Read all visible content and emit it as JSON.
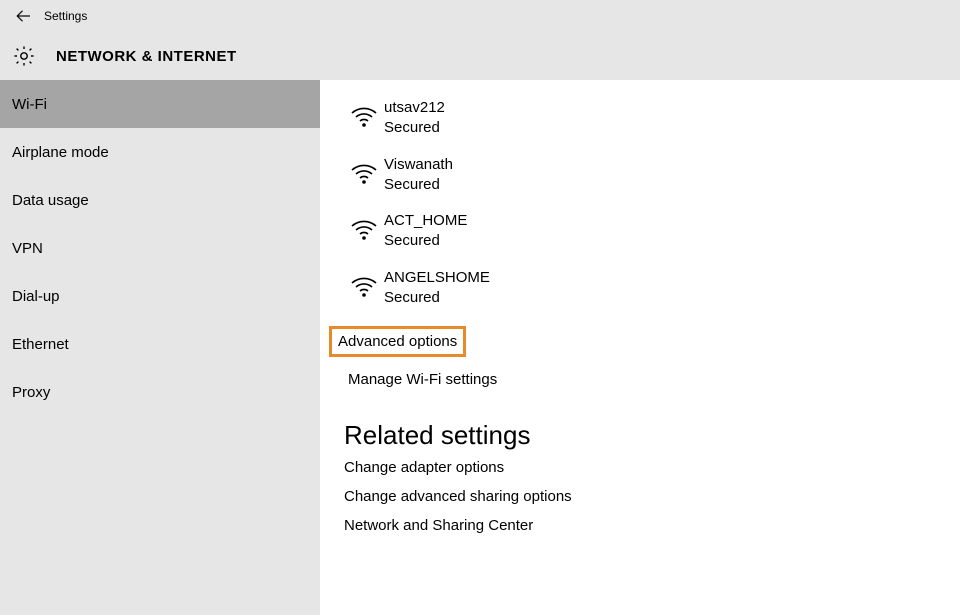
{
  "topbar": {
    "title": "Settings"
  },
  "header": {
    "title": "NETWORK & INTERNET"
  },
  "sidebar": {
    "items": [
      {
        "label": "Wi-Fi",
        "active": true
      },
      {
        "label": "Airplane mode"
      },
      {
        "label": "Data usage"
      },
      {
        "label": "VPN"
      },
      {
        "label": "Dial-up"
      },
      {
        "label": "Ethernet"
      },
      {
        "label": "Proxy"
      }
    ]
  },
  "wifi": {
    "networks": [
      {
        "name": "utsav212",
        "status": "Secured"
      },
      {
        "name": "Viswanath",
        "status": "Secured"
      },
      {
        "name": "ACT_HOME",
        "status": "Secured"
      },
      {
        "name": "ANGELSHOME",
        "status": "Secured"
      }
    ],
    "advanced_label": "Advanced options",
    "manage_label": "Manage Wi-Fi settings"
  },
  "related": {
    "title": "Related settings",
    "links": [
      "Change adapter options",
      "Change advanced sharing options",
      "Network and Sharing Center"
    ]
  }
}
